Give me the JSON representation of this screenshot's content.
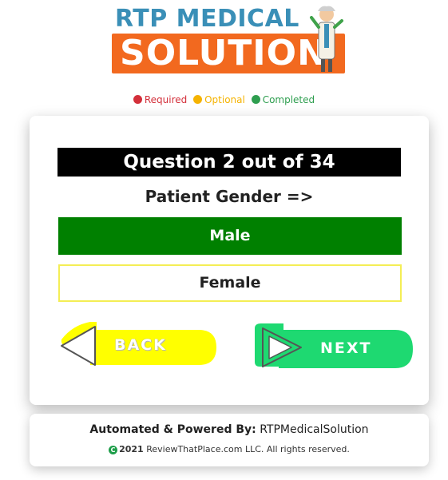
{
  "logo": {
    "line1": "RTP MEDICAL",
    "line2": "SOLUTION",
    "colors": {
      "line1": "#3a8fb7",
      "band": "#f2691f"
    }
  },
  "legend": [
    {
      "label": "Required",
      "color": "#d32f3a"
    },
    {
      "label": "Optional",
      "color": "#f5b301"
    },
    {
      "label": "Completed",
      "color": "#2e9e4f"
    }
  ],
  "question": {
    "header": "Question 2 out of 34",
    "label": "Patient Gender =>",
    "options": [
      {
        "label": "Male",
        "selected": true
      },
      {
        "label": "Female",
        "selected": false
      }
    ]
  },
  "navigation": {
    "back_label": "BACK",
    "next_label": "NEXT",
    "back_icon": "triangle-left-icon",
    "next_icon": "triangle-right-icon"
  },
  "footer": {
    "powered_prefix": "Automated & Powered By:",
    "powered_name": "RTPMedicalSolution",
    "copyright_icon": "copyright-icon",
    "copyright_year": "2021",
    "copyright_text": "ReviewThatPlace.com LLC. All rights reserved."
  }
}
